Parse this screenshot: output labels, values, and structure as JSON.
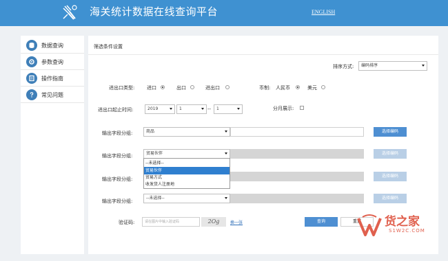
{
  "header": {
    "title": "海关统计数据在线查询平台",
    "lang_link": "ENGLISH"
  },
  "sidebar": {
    "items": [
      {
        "label": "数据查询",
        "icon": "database-icon"
      },
      {
        "label": "参数查询",
        "icon": "settings-icon"
      },
      {
        "label": "操作指南",
        "icon": "guide-icon"
      },
      {
        "label": "常见问题",
        "icon": "question-icon"
      }
    ]
  },
  "panel": {
    "title": "筛选条件设置",
    "sort_label": "排序方式:",
    "sort_value": "编码排序",
    "trade_type_label": "进出口类型:",
    "trade_options": [
      "进口",
      "出口",
      "进出口"
    ],
    "trade_selected": "进口",
    "currency_label": "币制:",
    "currency_options": [
      "人民币",
      "美元"
    ],
    "currency_selected": "人民币",
    "period_label": "进出口起止时间:",
    "year": "2019",
    "month_start": "1",
    "range_sep": "--",
    "month_end": "1",
    "monthly_label": "分月展示:",
    "output_label": "输出字段分组:",
    "groups": [
      {
        "value": "商品",
        "button": "选择编码"
      },
      {
        "value": "贸易伙伴",
        "button": "选择编码"
      },
      {
        "value": "",
        "button": "选择编码"
      },
      {
        "value": "--未选择--",
        "button": "选择编码"
      }
    ],
    "dropdown_options": [
      "--未选择--",
      "贸易伙伴",
      "贸易方式",
      "收发货人注册地"
    ],
    "dropdown_active": "贸易伙伴",
    "captcha_label": "验证码:",
    "captcha_placeholder": "请在图片中输入验证码",
    "captcha_text": "2Og",
    "refresh_link": "换一张",
    "query_button": "查询",
    "reset_button": "重置"
  },
  "watermark": {
    "title": "货之家",
    "sub": "S1W2C.COM"
  },
  "colors": {
    "header_bg": "#3f91d1",
    "button_blue": "#4e8fd2",
    "dropdown_highlight": "#2f7fcf",
    "watermark": "#e0604e"
  }
}
